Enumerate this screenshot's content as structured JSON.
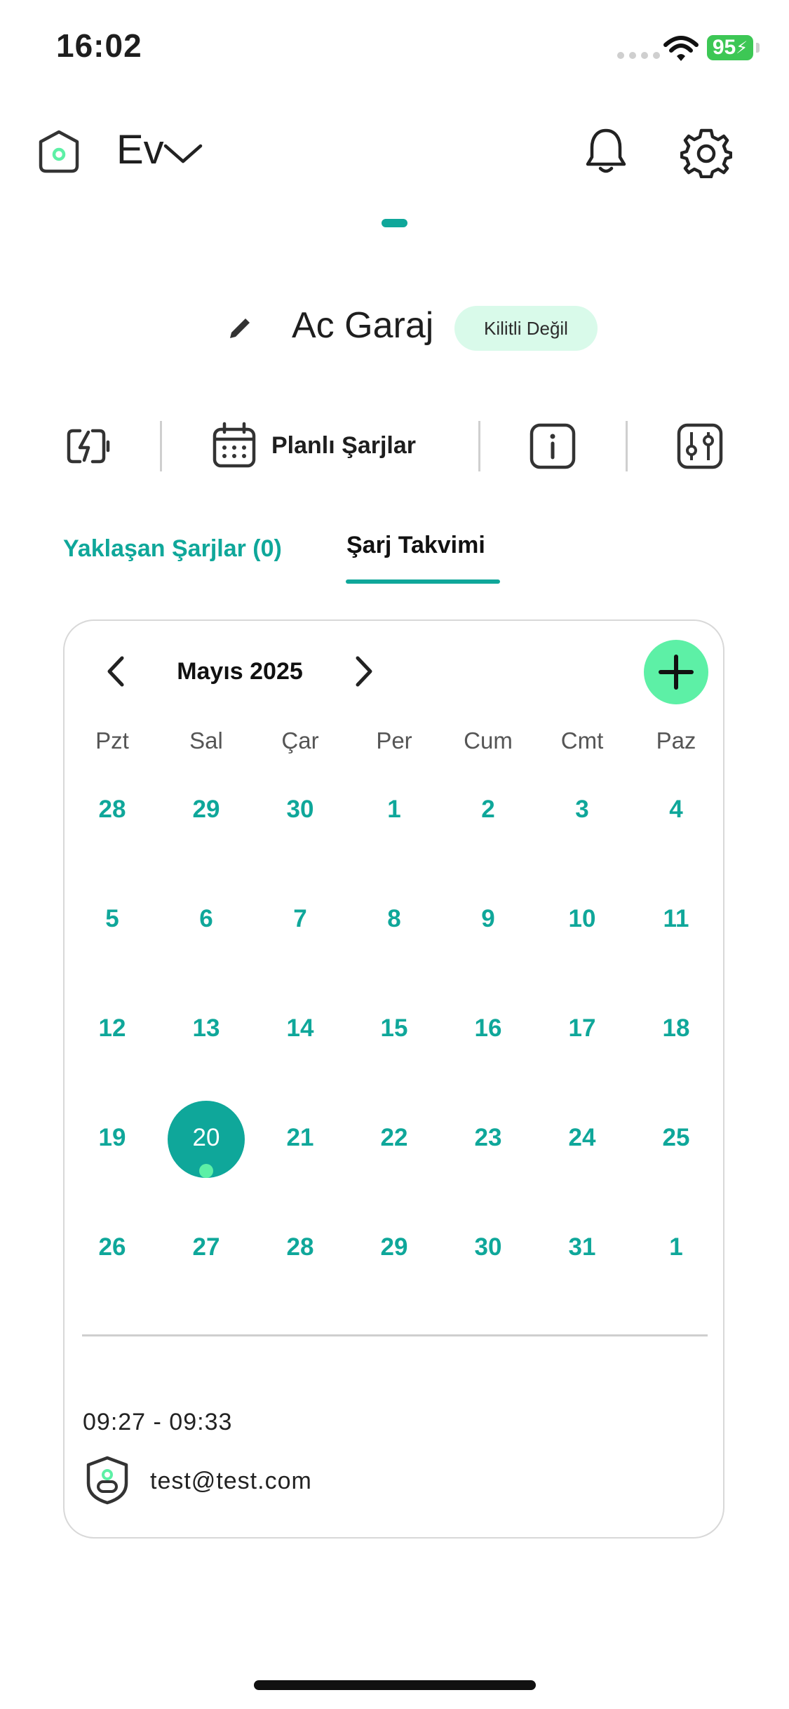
{
  "status_bar": {
    "time": "16:02",
    "battery": "95"
  },
  "header": {
    "home_name": "Ev"
  },
  "station": {
    "name": "Ac Garaj",
    "lock_status": "Kilitli Değil"
  },
  "toolbar": {
    "planned_charges_label": "Planlı Şarjlar"
  },
  "tabs": [
    {
      "label": "Yaklaşan Şarjlar (0)",
      "active": false
    },
    {
      "label": "Şarj Takvimi",
      "active": true
    }
  ],
  "calendar": {
    "month_label": "Mayıs 2025",
    "weekdays": [
      "Pzt",
      "Sal",
      "Çar",
      "Per",
      "Cum",
      "Cmt",
      "Paz"
    ],
    "weeks": [
      [
        "28",
        "29",
        "30",
        "1",
        "2",
        "3",
        "4"
      ],
      [
        "5",
        "6",
        "7",
        "8",
        "9",
        "10",
        "11"
      ],
      [
        "12",
        "13",
        "14",
        "15",
        "16",
        "17",
        "18"
      ],
      [
        "19",
        "20",
        "21",
        "22",
        "23",
        "24",
        "25"
      ],
      [
        "26",
        "27",
        "28",
        "29",
        "30",
        "31",
        "1"
      ]
    ],
    "selected_day": "20"
  },
  "event": {
    "time_range": "09:27 - 09:33",
    "user": "test@test.com"
  },
  "colors": {
    "accent": "#0fa79a",
    "accent_light": "#5df0a6",
    "badge_bg": "#d9faea",
    "battery": "#3dc755"
  }
}
